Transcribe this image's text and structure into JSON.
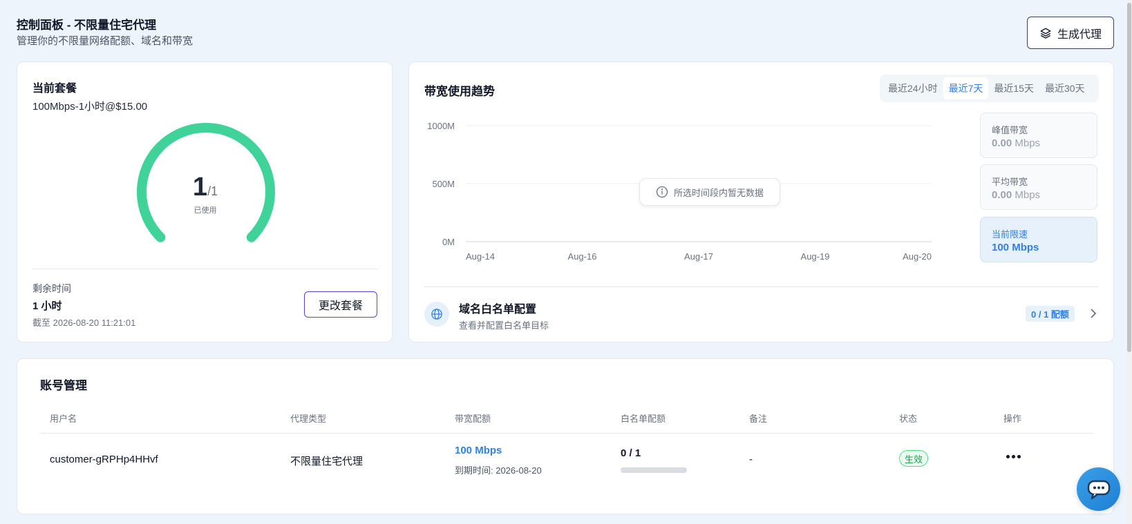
{
  "header": {
    "title": "控制面板 - 不限量住宅代理",
    "subtitle": "管理你的不限量网络配额、域名和带宽",
    "generate_button": "生成代理"
  },
  "plan": {
    "label": "当前套餐",
    "value": "100Mbps-1小时@$15.00",
    "gauge": {
      "used": "1",
      "total": "/1",
      "caption": "已使用",
      "fraction": 1.0,
      "color": "#3fd39a"
    },
    "remaining_label": "剩余时间",
    "remaining_value": "1 小时",
    "expires": "截至 2026-08-20 11:21:01",
    "change_button": "更改套餐"
  },
  "bandwidth": {
    "title": "带宽使用趋势",
    "ranges": [
      {
        "label": "最近24小时",
        "active": false
      },
      {
        "label": "最近7天",
        "active": true
      },
      {
        "label": "最近15天",
        "active": false
      },
      {
        "label": "最近30天",
        "active": false
      }
    ],
    "empty_message": "所选时间段内暂无数据",
    "stats": {
      "peak": {
        "label": "峰值带宽",
        "value": "0.00",
        "unit": "Mbps"
      },
      "average": {
        "label": "平均带宽",
        "value": "0.00",
        "unit": "Mbps"
      },
      "limit": {
        "label": "当前限速",
        "value": "100 Mbps"
      }
    },
    "whitelist": {
      "title": "域名白名单配置",
      "subtitle": "查看并配置白名单目标",
      "badge": "0 / 1 配额"
    }
  },
  "chart_data": {
    "type": "line",
    "x": [
      "Aug-14",
      "Aug-16",
      "Aug-17",
      "Aug-19",
      "Aug-20"
    ],
    "yticks": [
      "1000M",
      "500M",
      "0M"
    ],
    "ylim": [
      0,
      1000
    ],
    "series": [],
    "grid": true
  },
  "accounts": {
    "title": "账号管理",
    "columns": [
      "用户名",
      "代理类型",
      "带宽配额",
      "白名单配额",
      "备注",
      "状态",
      "操作"
    ],
    "rows": [
      {
        "username": "customer-gRPHp4HHvf",
        "proxy_type": "不限量住宅代理",
        "bandwidth": "100 Mbps",
        "bandwidth_expiry": "到期时间: 2026-08-20",
        "whitelist": "0 / 1",
        "whitelist_fraction": 0,
        "note": "-",
        "status": "生效"
      }
    ]
  },
  "colors": {
    "accent": "#2f80ed",
    "gauge": "#3fd39a",
    "status_green": "#16a34a"
  }
}
